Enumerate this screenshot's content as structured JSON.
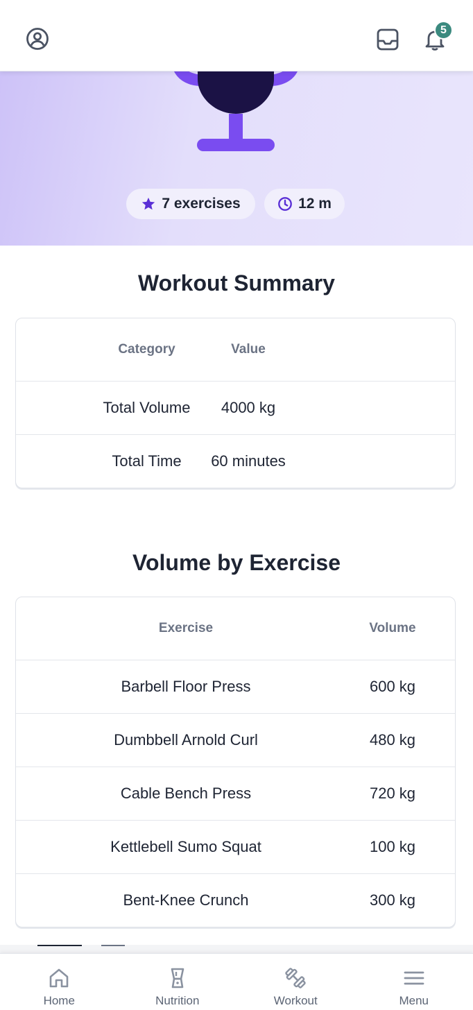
{
  "header": {
    "profile_icon": "user-circle-icon",
    "inbox_icon": "inbox-icon",
    "bell_icon": "bell-icon",
    "notification_count": "5"
  },
  "hero": {
    "exercises_label": "7 exercises",
    "duration_label": "12 m",
    "colors": {
      "accent": "#7a4cf0",
      "dark": "#1b1245",
      "badge": "#3b8a7f"
    }
  },
  "summary": {
    "title": "Workout Summary",
    "columns": [
      "Category",
      "Value"
    ],
    "rows": [
      [
        "Total Volume",
        "4000 kg"
      ],
      [
        "Total Time",
        "60 minutes"
      ]
    ]
  },
  "volume": {
    "title": "Volume by Exercise",
    "columns": [
      "Exercise",
      "Volume"
    ],
    "rows": [
      [
        "Barbell Floor Press",
        "600 kg"
      ],
      [
        "Dumbbell Arnold Curl",
        "480 kg"
      ],
      [
        "Cable Bench Press",
        "720 kg"
      ],
      [
        "Kettlebell Sumo Squat",
        "100 kg"
      ],
      [
        "Bent-Knee Crunch",
        "300 kg"
      ]
    ]
  },
  "nav": {
    "items": [
      {
        "label": "Home",
        "icon": "home-icon"
      },
      {
        "label": "Nutrition",
        "icon": "blender-icon"
      },
      {
        "label": "Workout",
        "icon": "dumbbell-icon"
      },
      {
        "label": "Menu",
        "icon": "menu-icon"
      }
    ]
  }
}
